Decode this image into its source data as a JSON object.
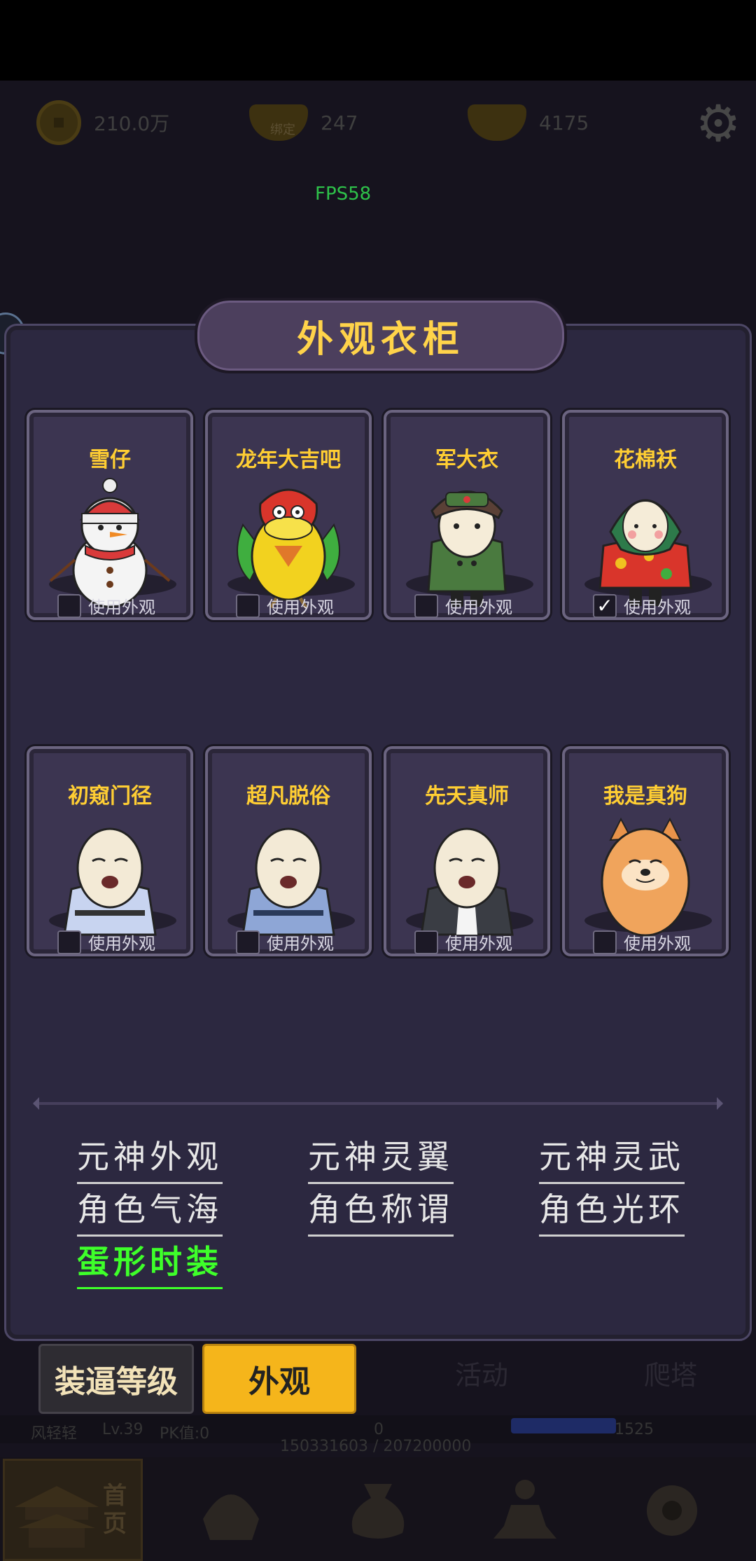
{
  "topbar": {
    "coins": "210.0万",
    "bound_gold": "247",
    "bound_tag": "绑定",
    "gold": "4175",
    "fps": "FPS58"
  },
  "wardrobe": {
    "title": "外观衣柜",
    "use_label": "使用外观",
    "items": [
      {
        "name": "雪仔",
        "checked": false
      },
      {
        "name": "龙年大吉吧",
        "checked": false
      },
      {
        "name": "军大衣",
        "checked": false
      },
      {
        "name": "花棉袄",
        "checked": true
      },
      {
        "name": "初窥门径",
        "checked": false
      },
      {
        "name": "超凡脱俗",
        "checked": false
      },
      {
        "name": "先天真师",
        "checked": false
      },
      {
        "name": "我是真狗",
        "checked": false
      }
    ],
    "options": [
      {
        "label": "元神外观"
      },
      {
        "label": "元神灵翼"
      },
      {
        "label": "元神灵武"
      },
      {
        "label": "角色气海"
      },
      {
        "label": "角色称谓"
      },
      {
        "label": "角色光环"
      },
      {
        "label": "蛋形时装"
      }
    ]
  },
  "tabs": {
    "level": "装逼等级",
    "look": "外观",
    "activity": "活动",
    "tower": "爬塔"
  },
  "player": {
    "name": "风轻轻",
    "level": "Lv.39",
    "pk": "PK值:0",
    "center": "0",
    "right": "1525",
    "exp": "150331603 / 207200000"
  },
  "nav": {
    "home": "首页"
  }
}
